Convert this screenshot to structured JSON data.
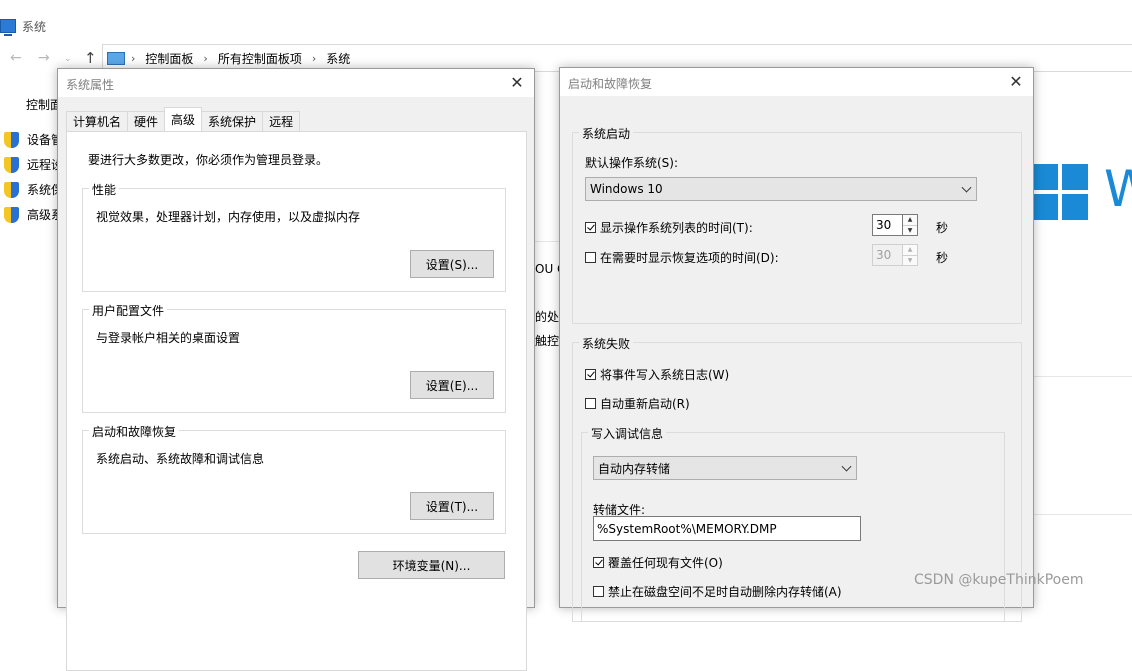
{
  "background_window": {
    "title": "系统",
    "breadcrumb": [
      "控制面板",
      "所有控制面板项",
      "系统"
    ],
    "sidebar_title": "控制面",
    "links": [
      "设备管",
      "远程设",
      "系统保",
      "高级系"
    ],
    "partial_text": [
      "OU C",
      "的处",
      "触控"
    ],
    "logo_partial": "W"
  },
  "system_properties": {
    "title": "系统属性",
    "close": "✕",
    "tabs": [
      "计算机名",
      "硬件",
      "高级",
      "系统保护",
      "远程"
    ],
    "active_tab": "高级",
    "admin_note": "要进行大多数更改，你必须作为管理员登录。",
    "performance": {
      "label": "性能",
      "desc": "视觉效果，处理器计划，内存使用，以及虚拟内存",
      "button": "设置(S)..."
    },
    "user_profiles": {
      "label": "用户配置文件",
      "desc": "与登录帐户相关的桌面设置",
      "button": "设置(E)..."
    },
    "startup_recovery": {
      "label": "启动和故障恢复",
      "desc": "系统启动、系统故障和调试信息",
      "button": "设置(T)..."
    },
    "env_button": "环境变量(N)..."
  },
  "startup_dialog": {
    "title": "启动和故障恢复",
    "close": "✕",
    "system_startup": {
      "label": "系统启动",
      "default_os_label": "默认操作系统(S):",
      "default_os_value": "Windows 10",
      "show_list_label": "显示操作系统列表的时间(T):",
      "show_list_checked": true,
      "show_list_value": "30",
      "show_recovery_label": "在需要时显示恢复选项的时间(D):",
      "show_recovery_checked": false,
      "show_recovery_value": "30",
      "seconds": "秒"
    },
    "system_failure": {
      "label": "系统失败",
      "write_event_label": "将事件写入系统日志(W)",
      "write_event_checked": true,
      "auto_restart_label": "自动重新启动(R)",
      "auto_restart_checked": false,
      "debug_info": {
        "label": "写入调试信息",
        "dump_type": "自动内存转储",
        "dump_file_label": "转储文件:",
        "dump_file_value": "%SystemRoot%\\MEMORY.DMP",
        "overwrite_label": "覆盖任何现有文件(O)",
        "overwrite_checked": true,
        "disable_auto_delete_label": "禁止在磁盘空间不足时自动删除内存转储(A)",
        "disable_auto_delete_checked": false
      }
    }
  },
  "watermark": "CSDN @kupeThinkPoem",
  "colors": {
    "accent": "#1a8ad6",
    "dialog_bg": "#f0f0f0",
    "button_bg": "#e1e1e1"
  }
}
